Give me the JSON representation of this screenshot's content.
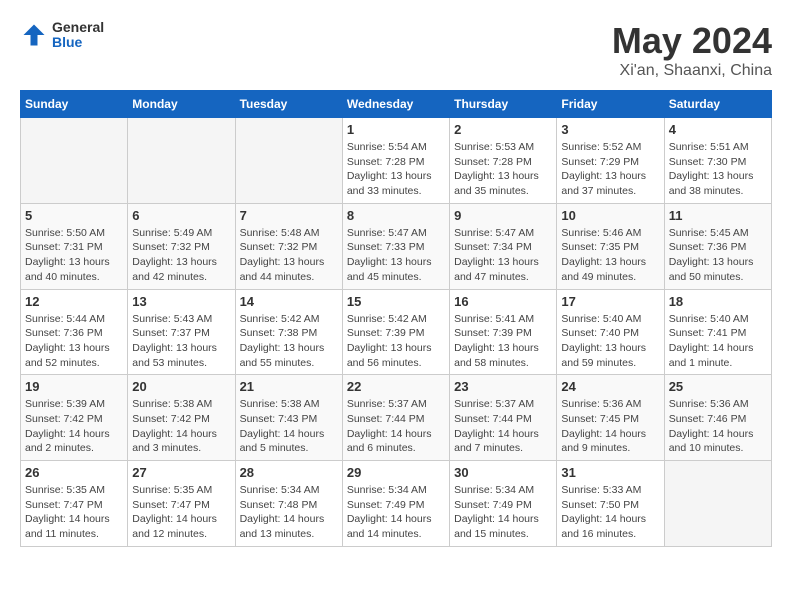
{
  "header": {
    "logo_general": "General",
    "logo_blue": "Blue",
    "month_year": "May 2024",
    "location": "Xi'an, Shaanxi, China"
  },
  "weekdays": [
    "Sunday",
    "Monday",
    "Tuesday",
    "Wednesday",
    "Thursday",
    "Friday",
    "Saturday"
  ],
  "weeks": [
    [
      {
        "day": "",
        "info": ""
      },
      {
        "day": "",
        "info": ""
      },
      {
        "day": "",
        "info": ""
      },
      {
        "day": "1",
        "info": "Sunrise: 5:54 AM\nSunset: 7:28 PM\nDaylight: 13 hours\nand 33 minutes."
      },
      {
        "day": "2",
        "info": "Sunrise: 5:53 AM\nSunset: 7:28 PM\nDaylight: 13 hours\nand 35 minutes."
      },
      {
        "day": "3",
        "info": "Sunrise: 5:52 AM\nSunset: 7:29 PM\nDaylight: 13 hours\nand 37 minutes."
      },
      {
        "day": "4",
        "info": "Sunrise: 5:51 AM\nSunset: 7:30 PM\nDaylight: 13 hours\nand 38 minutes."
      }
    ],
    [
      {
        "day": "5",
        "info": "Sunrise: 5:50 AM\nSunset: 7:31 PM\nDaylight: 13 hours\nand 40 minutes."
      },
      {
        "day": "6",
        "info": "Sunrise: 5:49 AM\nSunset: 7:32 PM\nDaylight: 13 hours\nand 42 minutes."
      },
      {
        "day": "7",
        "info": "Sunrise: 5:48 AM\nSunset: 7:32 PM\nDaylight: 13 hours\nand 44 minutes."
      },
      {
        "day": "8",
        "info": "Sunrise: 5:47 AM\nSunset: 7:33 PM\nDaylight: 13 hours\nand 45 minutes."
      },
      {
        "day": "9",
        "info": "Sunrise: 5:47 AM\nSunset: 7:34 PM\nDaylight: 13 hours\nand 47 minutes."
      },
      {
        "day": "10",
        "info": "Sunrise: 5:46 AM\nSunset: 7:35 PM\nDaylight: 13 hours\nand 49 minutes."
      },
      {
        "day": "11",
        "info": "Sunrise: 5:45 AM\nSunset: 7:36 PM\nDaylight: 13 hours\nand 50 minutes."
      }
    ],
    [
      {
        "day": "12",
        "info": "Sunrise: 5:44 AM\nSunset: 7:36 PM\nDaylight: 13 hours\nand 52 minutes."
      },
      {
        "day": "13",
        "info": "Sunrise: 5:43 AM\nSunset: 7:37 PM\nDaylight: 13 hours\nand 53 minutes."
      },
      {
        "day": "14",
        "info": "Sunrise: 5:42 AM\nSunset: 7:38 PM\nDaylight: 13 hours\nand 55 minutes."
      },
      {
        "day": "15",
        "info": "Sunrise: 5:42 AM\nSunset: 7:39 PM\nDaylight: 13 hours\nand 56 minutes."
      },
      {
        "day": "16",
        "info": "Sunrise: 5:41 AM\nSunset: 7:39 PM\nDaylight: 13 hours\nand 58 minutes."
      },
      {
        "day": "17",
        "info": "Sunrise: 5:40 AM\nSunset: 7:40 PM\nDaylight: 13 hours\nand 59 minutes."
      },
      {
        "day": "18",
        "info": "Sunrise: 5:40 AM\nSunset: 7:41 PM\nDaylight: 14 hours\nand 1 minute."
      }
    ],
    [
      {
        "day": "19",
        "info": "Sunrise: 5:39 AM\nSunset: 7:42 PM\nDaylight: 14 hours\nand 2 minutes."
      },
      {
        "day": "20",
        "info": "Sunrise: 5:38 AM\nSunset: 7:42 PM\nDaylight: 14 hours\nand 3 minutes."
      },
      {
        "day": "21",
        "info": "Sunrise: 5:38 AM\nSunset: 7:43 PM\nDaylight: 14 hours\nand 5 minutes."
      },
      {
        "day": "22",
        "info": "Sunrise: 5:37 AM\nSunset: 7:44 PM\nDaylight: 14 hours\nand 6 minutes."
      },
      {
        "day": "23",
        "info": "Sunrise: 5:37 AM\nSunset: 7:44 PM\nDaylight: 14 hours\nand 7 minutes."
      },
      {
        "day": "24",
        "info": "Sunrise: 5:36 AM\nSunset: 7:45 PM\nDaylight: 14 hours\nand 9 minutes."
      },
      {
        "day": "25",
        "info": "Sunrise: 5:36 AM\nSunset: 7:46 PM\nDaylight: 14 hours\nand 10 minutes."
      }
    ],
    [
      {
        "day": "26",
        "info": "Sunrise: 5:35 AM\nSunset: 7:47 PM\nDaylight: 14 hours\nand 11 minutes."
      },
      {
        "day": "27",
        "info": "Sunrise: 5:35 AM\nSunset: 7:47 PM\nDaylight: 14 hours\nand 12 minutes."
      },
      {
        "day": "28",
        "info": "Sunrise: 5:34 AM\nSunset: 7:48 PM\nDaylight: 14 hours\nand 13 minutes."
      },
      {
        "day": "29",
        "info": "Sunrise: 5:34 AM\nSunset: 7:49 PM\nDaylight: 14 hours\nand 14 minutes."
      },
      {
        "day": "30",
        "info": "Sunrise: 5:34 AM\nSunset: 7:49 PM\nDaylight: 14 hours\nand 15 minutes."
      },
      {
        "day": "31",
        "info": "Sunrise: 5:33 AM\nSunset: 7:50 PM\nDaylight: 14 hours\nand 16 minutes."
      },
      {
        "day": "",
        "info": ""
      }
    ]
  ]
}
